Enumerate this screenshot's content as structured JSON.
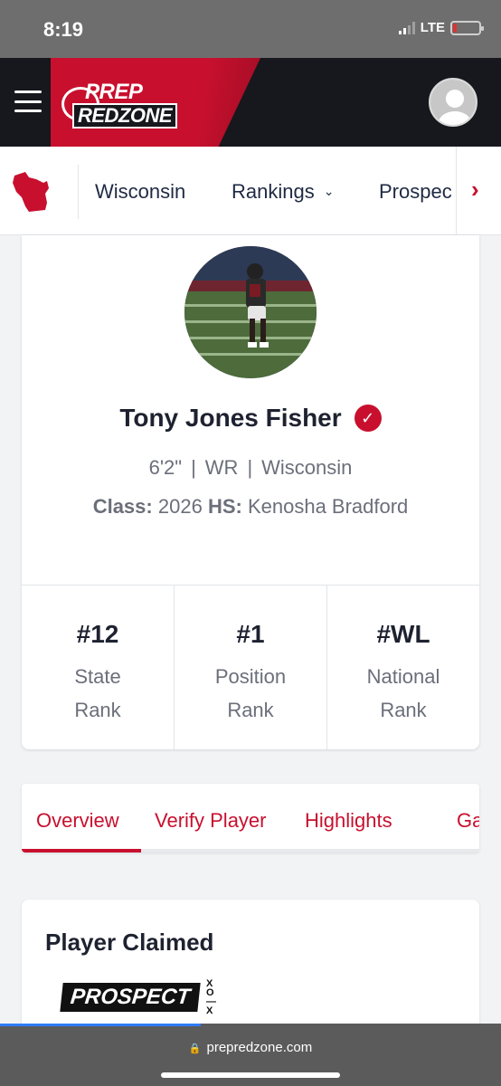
{
  "status_bar": {
    "time": "8:19",
    "network": "LTE",
    "battery_level": 0.15
  },
  "header": {
    "logo_line1": "PREP",
    "logo_line2": "REDZONE",
    "accent_color": "#c8102e"
  },
  "nav": {
    "state": "Wisconsin",
    "rankings": "Rankings",
    "prospects": "Prospec"
  },
  "player": {
    "name": "Tony Jones Fisher",
    "height": "6'2\"",
    "position": "WR",
    "state": "Wisconsin",
    "class_label": "Class:",
    "class_value": "2026",
    "hs_label": "HS:",
    "hs_value": "Kenosha Bradford",
    "verified_icon": "check-badge-icon"
  },
  "ranks": [
    {
      "value": "#12",
      "label1": "State",
      "label2": "Rank"
    },
    {
      "value": "#1",
      "label1": "Position",
      "label2": "Rank"
    },
    {
      "value": "#WL",
      "label1": "National",
      "label2": "Rank"
    }
  ],
  "tabs": [
    "Overview",
    "Verify Player",
    "Highlights",
    "Galle"
  ],
  "active_tab": "Overview",
  "claimed": {
    "title": "Player Claimed",
    "logo_text": "PROSPECT",
    "logo_marks": "X O—X"
  },
  "browser": {
    "url": "prepredzone.com"
  }
}
